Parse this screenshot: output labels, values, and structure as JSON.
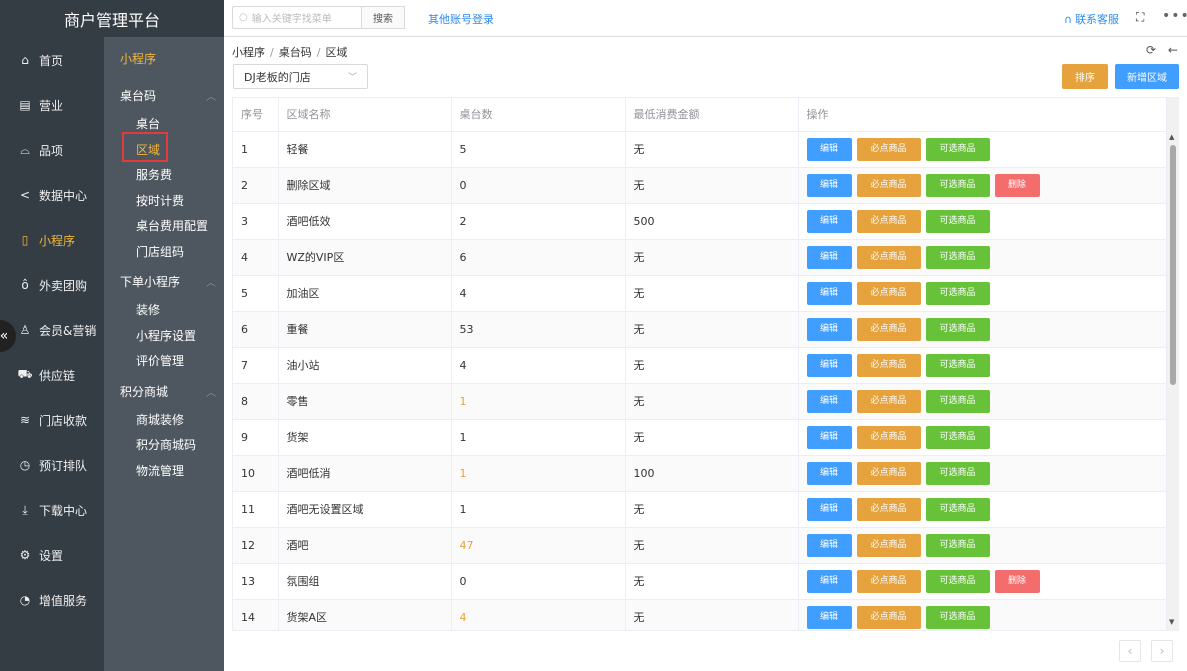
{
  "app": {
    "title": "商户管理平台"
  },
  "rail": [
    {
      "label": "首页",
      "icon": "home-icon"
    },
    {
      "label": "营业",
      "icon": "calendar-icon"
    },
    {
      "label": "品项",
      "icon": "bag-icon"
    },
    {
      "label": "数据中心",
      "icon": "share-icon"
    },
    {
      "label": "小程序",
      "icon": "mobile-icon",
      "active": true
    },
    {
      "label": "外卖团购",
      "icon": "bike-icon"
    },
    {
      "label": "会员&营销",
      "icon": "user-icon"
    },
    {
      "label": "供应链",
      "icon": "truck-icon"
    },
    {
      "label": "门店收款",
      "icon": "database-icon"
    },
    {
      "label": "预订排队",
      "icon": "clock-icon"
    },
    {
      "label": "下载中心",
      "icon": "download-icon"
    },
    {
      "label": "设置",
      "icon": "gear-icon"
    },
    {
      "label": "增值服务",
      "icon": "alarm-icon"
    }
  ],
  "subnav": {
    "title": "小程序",
    "groups": [
      {
        "label": "桌台码",
        "items": [
          "桌台",
          "区域",
          "服务费",
          "按时计费",
          "桌台费用配置",
          "门店组码"
        ]
      },
      {
        "label": "下单小程序",
        "items": [
          "装修",
          "小程序设置",
          "评价管理"
        ]
      },
      {
        "label": "积分商城",
        "items": [
          "商城装修",
          "积分商城码",
          "物流管理"
        ]
      }
    ],
    "active_item": "区域"
  },
  "topbar": {
    "search_placeholder": "输入关键字找菜单",
    "search_btn": "搜索",
    "other_login": "其他账号登录",
    "contact": "联系客服",
    "more": "•••"
  },
  "breadcrumb": [
    "小程序",
    "桌台码",
    "区域"
  ],
  "store_select": "DJ老板的门店",
  "buttons": {
    "sort": "排序",
    "new_area": "新增区域"
  },
  "table": {
    "headers": [
      "序号",
      "区域名称",
      "桌台数",
      "最低消费金额",
      "操作"
    ],
    "actions": {
      "edit": "编辑",
      "must": "必点商品",
      "optional": "可选商品",
      "delete": "删除"
    },
    "rows": [
      {
        "no": "1",
        "name": "轻餐",
        "tables": "5",
        "min": "无",
        "del": false
      },
      {
        "no": "2",
        "name": "删除区域",
        "tables": "0",
        "min": "无",
        "del": true
      },
      {
        "no": "3",
        "name": "酒吧低效",
        "tables": "2",
        "min": "500",
        "del": false
      },
      {
        "no": "4",
        "name": "WZ的VIP区",
        "tables": "6",
        "min": "无",
        "del": false
      },
      {
        "no": "5",
        "name": "加油区",
        "tables": "4",
        "min": "无",
        "del": false
      },
      {
        "no": "6",
        "name": "重餐",
        "tables": "53",
        "min": "无",
        "del": false
      },
      {
        "no": "7",
        "name": "油小站",
        "tables": "4",
        "min": "无",
        "del": false
      },
      {
        "no": "8",
        "name": "零售",
        "tables": "1",
        "min": "无",
        "del": false,
        "hl": true
      },
      {
        "no": "9",
        "name": "货架",
        "tables": "1",
        "min": "无",
        "del": false
      },
      {
        "no": "10",
        "name": "酒吧低消",
        "tables": "1",
        "min": "100",
        "del": false,
        "hl": true
      },
      {
        "no": "11",
        "name": "酒吧无设置区域",
        "tables": "1",
        "min": "无",
        "del": false
      },
      {
        "no": "12",
        "name": "酒吧",
        "tables": "47",
        "min": "无",
        "del": false,
        "hl": true
      },
      {
        "no": "13",
        "name": "氛围组",
        "tables": "0",
        "min": "无",
        "del": true
      },
      {
        "no": "14",
        "name": "货架A区",
        "tables": "4",
        "min": "无",
        "del": false,
        "hl": true
      }
    ]
  },
  "pager": {
    "prev": "‹",
    "next": "›"
  }
}
